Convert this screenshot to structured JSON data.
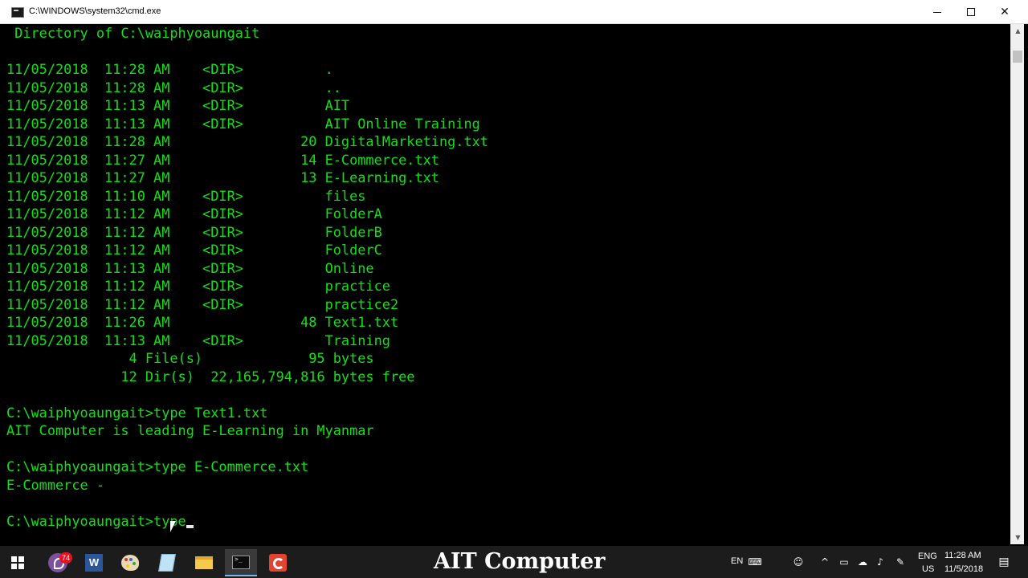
{
  "window": {
    "title": "C:\\WINDOWS\\system32\\cmd.exe",
    "minimize_label": "—",
    "close_label": "✕"
  },
  "console": {
    "text_color": "#13e013",
    "lines": [
      " Directory of C:\\waiphyoaungait",
      "",
      "11/05/2018  11:28 AM    <DIR>          .",
      "11/05/2018  11:28 AM    <DIR>          ..",
      "11/05/2018  11:13 AM    <DIR>          AIT",
      "11/05/2018  11:13 AM    <DIR>          AIT Online Training",
      "11/05/2018  11:28 AM                20 DigitalMarketing.txt",
      "11/05/2018  11:27 AM                14 E-Commerce.txt",
      "11/05/2018  11:27 AM                13 E-Learning.txt",
      "11/05/2018  11:10 AM    <DIR>          files",
      "11/05/2018  11:12 AM    <DIR>          FolderA",
      "11/05/2018  11:12 AM    <DIR>          FolderB",
      "11/05/2018  11:12 AM    <DIR>          FolderC",
      "11/05/2018  11:13 AM    <DIR>          Online",
      "11/05/2018  11:12 AM    <DIR>          practice",
      "11/05/2018  11:12 AM    <DIR>          practice2",
      "11/05/2018  11:26 AM                48 Text1.txt",
      "11/05/2018  11:13 AM    <DIR>          Training",
      "               4 File(s)             95 bytes",
      "              12 Dir(s)  22,165,794,816 bytes free",
      "",
      "C:\\waiphyoaungait>type Text1.txt",
      "AIT Computer is leading E-Learning in Myanmar",
      "",
      "C:\\waiphyoaungait>type E-Commerce.txt",
      "E-Commerce -",
      "",
      "C:\\waiphyoaungait>type"
    ]
  },
  "scrollbar": {
    "up_arrow": "▲",
    "down_arrow": "▼"
  },
  "taskbar": {
    "brand": "AIT Computer",
    "viber_badge": "74",
    "word_label": "W",
    "language_indicator": "EN",
    "lang_line1": "ENG",
    "lang_line2": "US",
    "time": "11:28 AM",
    "date": "11/5/2018",
    "tray_chevron": "^"
  },
  "icons": {
    "start": "windows-start-icon",
    "viber": "viber-icon",
    "word": "word-icon",
    "paint": "paint-icon",
    "notepad": "notepad-icon",
    "explorer": "file-explorer-icon",
    "cmd": "command-prompt-icon",
    "red_app": "red-app-icon"
  }
}
